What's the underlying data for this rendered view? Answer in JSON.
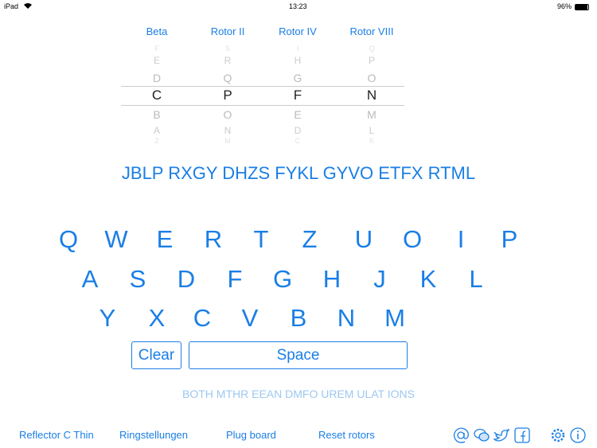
{
  "status": {
    "device": "iPad",
    "time": "13:23",
    "battery": "96%"
  },
  "rotors": [
    {
      "label": "Beta",
      "above": [
        "F",
        "E",
        "D"
      ],
      "selected": "C",
      "below": [
        "B",
        "A",
        "Z"
      ]
    },
    {
      "label": "Rotor II",
      "above": [
        "S",
        "R",
        "Q"
      ],
      "selected": "P",
      "below": [
        "O",
        "N",
        "M"
      ]
    },
    {
      "label": "Rotor IV",
      "above": [
        "I",
        "H",
        "G"
      ],
      "selected": "F",
      "below": [
        "E",
        "D",
        "C"
      ]
    },
    {
      "label": "Rotor VIII",
      "above": [
        "Q",
        "P",
        "O"
      ],
      "selected": "N",
      "below": [
        "M",
        "L",
        "K"
      ]
    }
  ],
  "output": "JBLP RXGY DHZS FYKL GYVO ETFX RTML",
  "keyboard": {
    "row1": [
      "Q",
      "W",
      "E",
      "R",
      "T",
      "Z",
      "U",
      "O",
      "I",
      "P"
    ],
    "row2": [
      "A",
      "S",
      "D",
      "F",
      "G",
      "H",
      "J",
      "K",
      "L"
    ],
    "row3": [
      "Y",
      "X",
      "C",
      "V",
      "B",
      "N",
      "M"
    ],
    "clear": "Clear",
    "space": "Space"
  },
  "input": "BOTH MTHR EEAN DMFO UREM ULAT IONS",
  "bottom": {
    "reflector": "Reflector C Thin",
    "ring": "Ringstellungen",
    "plug": "Plug board",
    "reset": "Reset rotors"
  },
  "icons": [
    "at-icon",
    "chat-icon",
    "twitter-icon",
    "facebook-icon",
    "gear-icon",
    "info-icon"
  ],
  "colors": {
    "accent": "#1a7ee6",
    "input_text": "#9cc8f0"
  }
}
